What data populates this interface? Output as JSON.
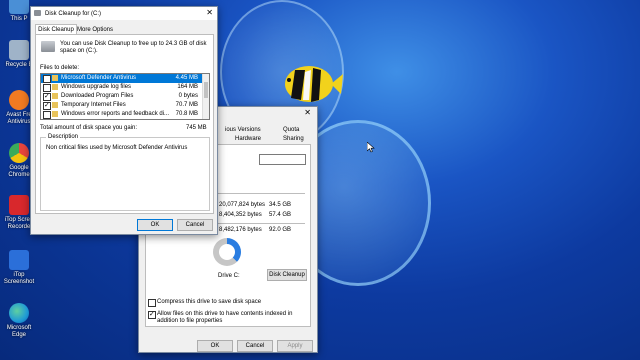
{
  "desktop": {
    "icons": [
      {
        "label": "This P",
        "color": "#4a8fd6"
      },
      {
        "label": "Recycle B",
        "color": "#9fb3c8"
      },
      {
        "label": "Avast Fre Antivirus",
        "color": "#f07a22"
      },
      {
        "label": "Google Chrome",
        "color": "#e8453c"
      },
      {
        "label": "iTop Scree Recorde",
        "color": "#d8282c"
      },
      {
        "label": "iTop Screenshot",
        "color": "#2b6fd9"
      },
      {
        "label": "Microsoft Edge",
        "color": "#1f9ad6"
      }
    ]
  },
  "disk_cleanup": {
    "title": "Disk Cleanup for  (C:)",
    "tabs": [
      "Disk Cleanup",
      "More Options"
    ],
    "intro": "You can use Disk Cleanup to free up to 24.3 GB of disk space on  (C:).",
    "files_label": "Files to delete:",
    "files": [
      {
        "name": "Microsoft Defender Antivirus",
        "size": "4.45 MB",
        "checked": false,
        "selected": true
      },
      {
        "name": "Windows upgrade log files",
        "size": "164 MB",
        "checked": false,
        "selected": false
      },
      {
        "name": "Downloaded Program Files",
        "size": "0 bytes",
        "checked": true,
        "selected": false
      },
      {
        "name": "Temporary Internet Files",
        "size": "70.7 MB",
        "checked": true,
        "selected": false
      },
      {
        "name": "Windows error reports and feedback di...",
        "size": "70.8 MB",
        "checked": false,
        "selected": false
      }
    ],
    "total_label": "Total amount of disk space you gain:",
    "total_value": "745 MB",
    "description_label": "Description",
    "description_text": "Non critical files used by Microsoft Defender Antivirus",
    "ok": "OK",
    "cancel": "Cancel",
    "accent": "#0078d7"
  },
  "properties": {
    "tabs_row1": [
      "ious Versions",
      "Quota"
    ],
    "tabs_row2": [
      "Hardware",
      "Sharing"
    ],
    "rows": [
      {
        "bytes": "20,077,824 bytes",
        "size": "34.5 GB"
      },
      {
        "bytes": "8,404,352 bytes",
        "size": "57.4 GB"
      },
      {
        "bytes": "8,482,176 bytes",
        "size": "92.0 GB"
      }
    ],
    "drive_label": "Drive C:",
    "disk_cleanup_button": "Disk Cleanup",
    "compress_label": "Compress this drive to save disk space",
    "index_label": "Allow files on this drive to have contents indexed in addition to file properties",
    "compress_checked": false,
    "index_checked": true,
    "ok": "OK",
    "cancel": "Cancel",
    "apply": "Apply",
    "used_fraction": 0.375,
    "used_color": "#2a7de1",
    "free_color": "#c6c6c6"
  }
}
